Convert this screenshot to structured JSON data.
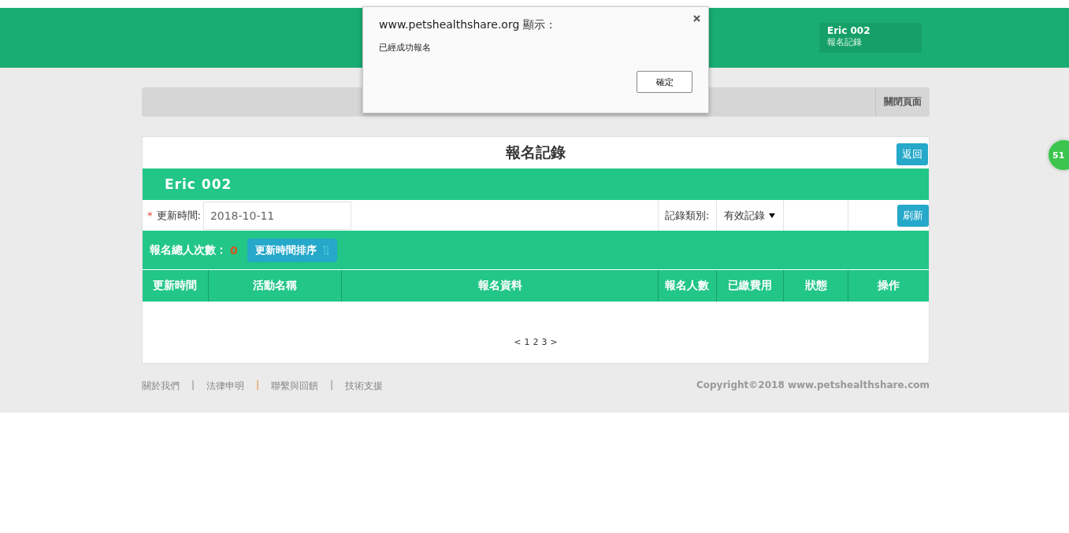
{
  "header": {
    "user_name": "Eric 002",
    "user_subtitle": "報名記錄"
  },
  "close_bar": {
    "close_label": "關閉頁面"
  },
  "card": {
    "title": "報名記錄",
    "back_button": "返回",
    "user_banner": "Eric 002",
    "filter": {
      "required_mark": "*",
      "time_label": "更新時間:",
      "time_value": "2018-10-11",
      "type_label": "記錄類別:",
      "type_value": "有效記錄",
      "refresh_button": "刷新"
    },
    "summary": {
      "label": "報名總人次數：",
      "count": "0",
      "sort_button": "更新時間排序"
    },
    "table": {
      "columns": [
        "更新時間",
        "活動名稱",
        "報名資料",
        "報名人數",
        "已繳費用",
        "狀態",
        "操作"
      ]
    },
    "pagination": [
      "<",
      "1",
      "2",
      "3",
      ">"
    ]
  },
  "footer": {
    "links": [
      "關於我們",
      "法律申明",
      "聯繫與回饋",
      "技術支援"
    ],
    "separators": [
      "|",
      "|",
      "|"
    ],
    "copyright": "Copyright©2018 www.petshealthshare.com"
  },
  "floating_badge": "51",
  "dialog": {
    "title": "www.petshealthshare.org 顯示：",
    "message": "已經成功報名",
    "ok_button": "確定"
  }
}
